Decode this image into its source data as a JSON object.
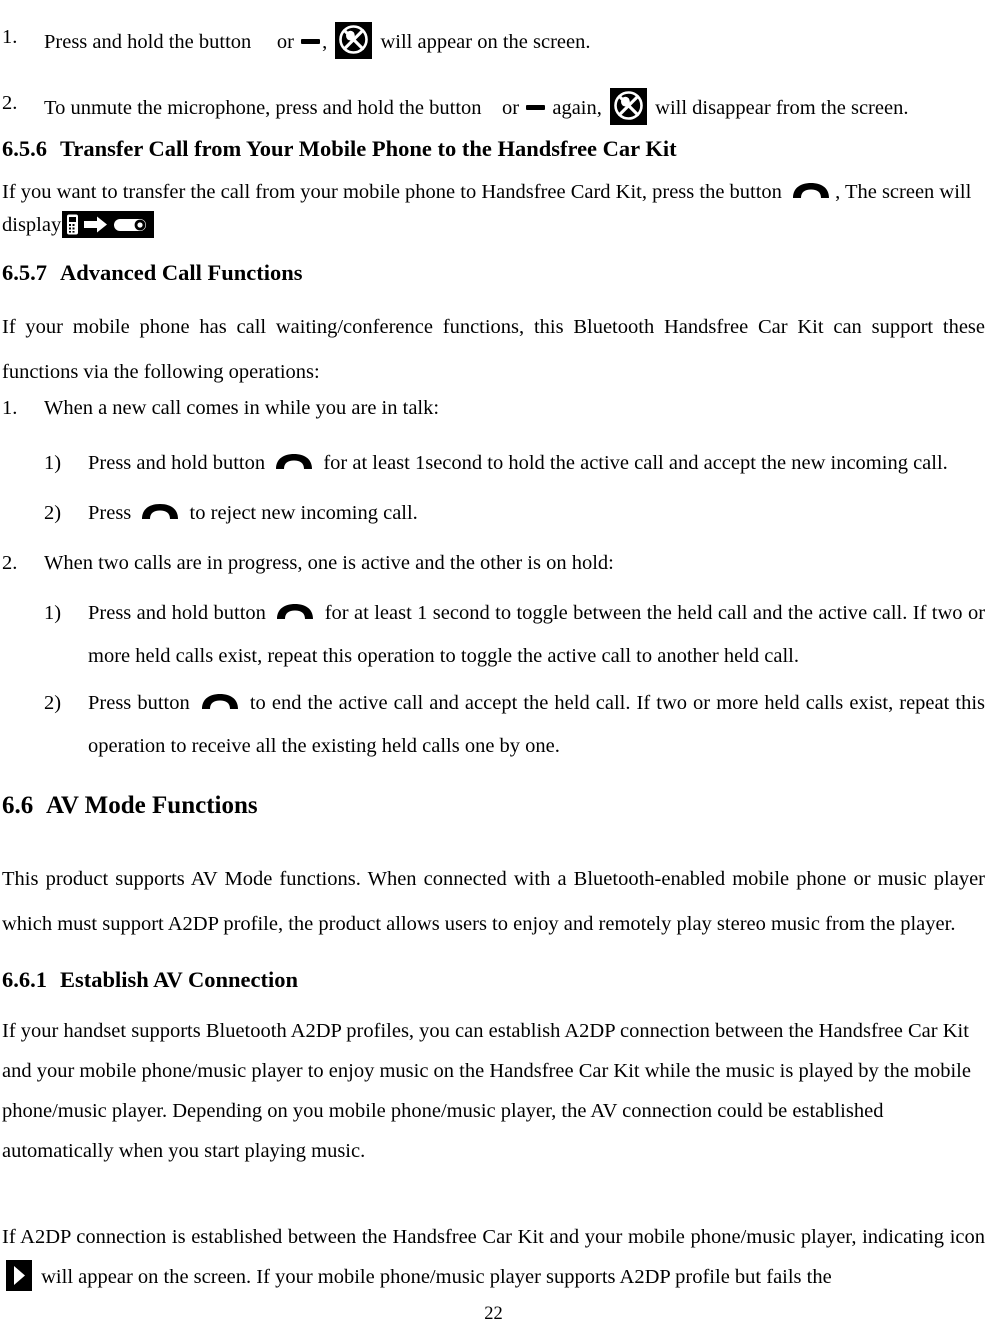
{
  "document": {
    "page_number": "22",
    "type": "product-manual-page"
  },
  "items": {
    "step1": {
      "marker": "1.",
      "text_before_dash": "Press and hold the button",
      "or": "or",
      "text_after_icon": "will appear on the screen.",
      "comma": ","
    },
    "step2": {
      "marker": "2.",
      "text_before_dash": "To unmute the microphone, press and hold the button",
      "or": "or",
      "again": "again,",
      "text_after_icon": "will disappear from the screen."
    }
  },
  "sections": {
    "s656": {
      "number": "6.5.6",
      "title": "Transfer Call from Your Mobile Phone to the Handsfree Car Kit",
      "body_before_icon": "If you want to transfer the call from your mobile phone to Handsfree Card Kit, press the button",
      "body_after_icon": ", The screen will display"
    },
    "s657": {
      "number": "6.5.7",
      "title": "Advanced Call Functions",
      "intro": "If your mobile phone has call waiting/conference functions, this Bluetooth Handsfree Car Kit can support these functions via the following operations:",
      "list": [
        {
          "marker": "1.",
          "text": "When a new call comes in while you are in talk:",
          "subitems": [
            {
              "marker": "1)",
              "before_icon": "Press and hold button",
              "after_icon": "for at least 1second to hold the active call and accept the new incoming call."
            },
            {
              "marker": "2)",
              "before_icon": "Press",
              "after_icon": "to reject new incoming call."
            }
          ]
        },
        {
          "marker": "2.",
          "text": "When two calls are in progress, one is active and the other is on hold:",
          "subitems": [
            {
              "marker": "1)",
              "before_icon": "Press and hold button",
              "after_icon": "for at least 1 second to toggle between the held call and the active call. If two or more held calls exist, repeat this operation to toggle the active call to another held call."
            },
            {
              "marker": "2)",
              "before_icon": "Press button",
              "after_icon": "to end the active call and accept the held call. If two or more held calls exist, repeat this operation to receive all the existing held calls one by one."
            }
          ]
        }
      ]
    },
    "s66": {
      "number": "6.6",
      "title": "AV Mode Functions",
      "body": "This product supports AV Mode functions. When connected with a Bluetooth-enabled mobile phone or music player which must support A2DP profile, the product allows users to enjoy and remotely play stereo music from the player."
    },
    "s661": {
      "number": "6.6.1",
      "title": "Establish AV Connection",
      "body1": "If your handset supports Bluetooth A2DP profiles, you can establish A2DP connection between the Handsfree Car Kit and your mobile phone/music player to enjoy music on the Handsfree Car Kit while the music is played by the mobile phone/music player. Depending on you mobile phone/music player, the AV connection could be established automatically when you start playing music.",
      "body2_before_icon": "If A2DP connection is established between the Handsfree Car Kit and your mobile phone/music player, indicating icon",
      "body2_after_icon": "will appear on the screen. If your mobile phone/music player supports A2DP profile but fails the"
    }
  },
  "icons": {
    "mute": "mute-indicator-icon",
    "dash": "dash-key-icon",
    "handset": "handset-key-icon",
    "transfer": "call-transfer-indicator-icon",
    "play": "a2dp-play-indicator-icon"
  },
  "colors": {
    "text": "#000000",
    "background": "#ffffff",
    "icon_tile": "#000000",
    "icon_glyph": "#ffffff"
  }
}
